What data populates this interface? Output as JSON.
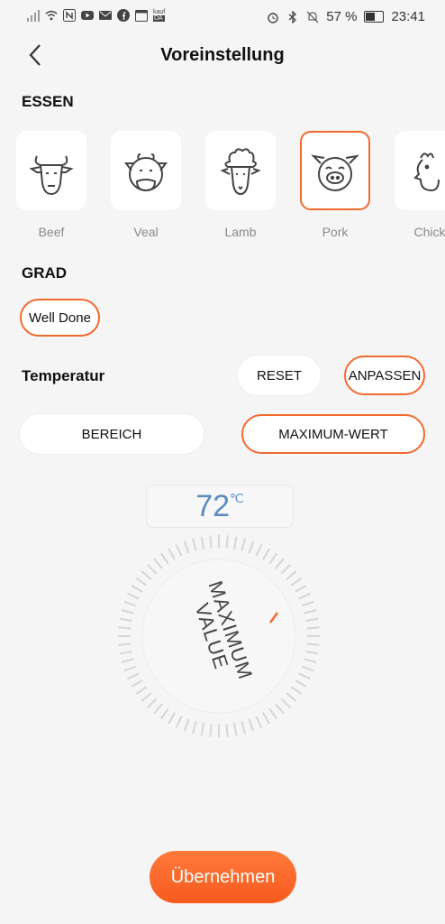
{
  "status_bar": {
    "battery": "57 %",
    "time": "23:41",
    "kaufda_top": "kauf",
    "kaufda_bottom": "DA"
  },
  "header": {
    "title": "Voreinstellung"
  },
  "essen": {
    "heading": "ESSEN",
    "items": [
      {
        "label": "Beef",
        "icon": "cow-icon",
        "selected": false
      },
      {
        "label": "Veal",
        "icon": "calf-icon",
        "selected": false
      },
      {
        "label": "Lamb",
        "icon": "sheep-icon",
        "selected": false
      },
      {
        "label": "Pork",
        "icon": "pig-icon",
        "selected": true
      },
      {
        "label": "Chick",
        "icon": "chicken-icon",
        "selected": false
      }
    ]
  },
  "grad": {
    "heading": "GRAD",
    "selected": "Well Done"
  },
  "temperatur": {
    "heading": "Temperatur",
    "reset_label": "RESET",
    "anpassen_label": "ANPASSEN",
    "bereich_label": "BEREICH",
    "maximum_label": "MAXIMUM-WERT",
    "value": "72",
    "unit": "℃",
    "dial_label_line1": "MAXIMUM",
    "dial_label_line2": "VALUE"
  },
  "footer": {
    "apply_label": "Übernehmen"
  },
  "colors": {
    "accent": "#f26a2e",
    "temp_text": "#5b8dc0"
  }
}
